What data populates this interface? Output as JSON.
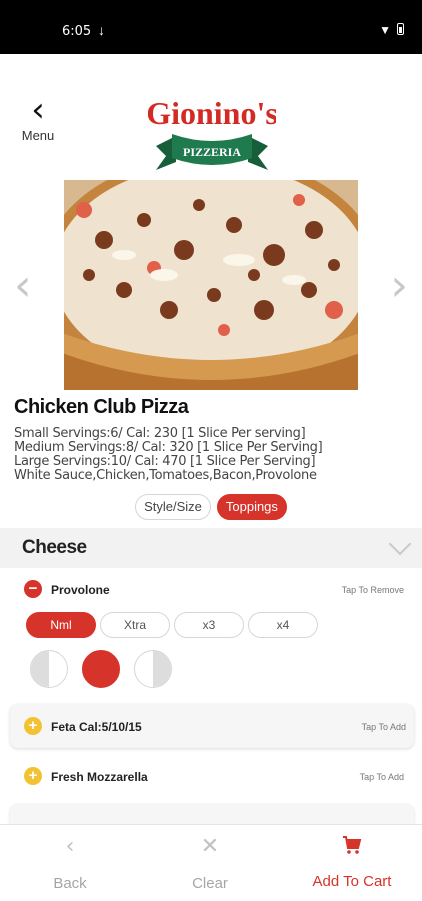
{
  "status": {
    "time": "6:05",
    "download_icon": "download-icon",
    "wifi_icon": "wifi-icon",
    "battery_icon": "battery-icon"
  },
  "header": {
    "back_label": "Menu",
    "logo_text": "Gionino's",
    "logo_banner": "PIZZERIA"
  },
  "item": {
    "title": "Chicken Club Pizza",
    "description": [
      "Small Servings:6/ Cal: 230 [1 Slice Per serving]",
      "Medium Servings:8/ Cal: 320 [1 Slice Per Serving]",
      "Large Servings:10/ Cal: 470 [1 Slice Per Serving]",
      "White Sauce,Chicken,Tomatoes,Bacon,Provolone"
    ]
  },
  "tabs": {
    "style": "Style/Size",
    "toppings": "Toppings",
    "active": "Toppings"
  },
  "section": {
    "title": "Cheese"
  },
  "toppings": [
    {
      "name": "Provolone",
      "action": "Tap To Remove",
      "selected": true
    },
    {
      "name": "Feta Cal:5/10/15",
      "action": "Tap To Add",
      "selected": false
    },
    {
      "name": "Fresh Mozzarella",
      "action": "Tap To Add",
      "selected": false
    }
  ],
  "amounts": [
    "Nml",
    "Xtra",
    "x3",
    "x4"
  ],
  "amount_selected": "Nml",
  "placement": {
    "options": [
      "left-half",
      "whole",
      "right-half"
    ],
    "selected": "whole"
  },
  "bottom": {
    "back": "Back",
    "clear": "Clear",
    "cart": "Add To Cart"
  },
  "colors": {
    "accent": "#d6332a",
    "add_icon": "#f2c232",
    "logo_red": "#d32a23",
    "logo_green": "#1f7a4d"
  }
}
